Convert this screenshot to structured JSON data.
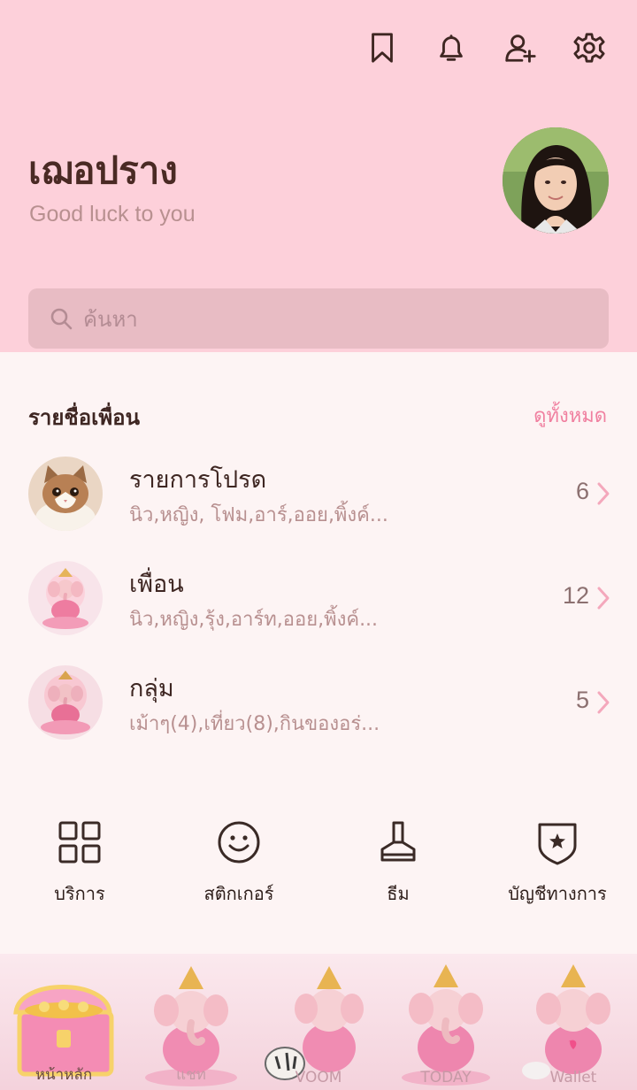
{
  "header": {
    "icons": [
      "bookmark-icon",
      "bell-icon",
      "add-friend-icon",
      "gear-icon"
    ],
    "profile_name": "เฌอปราง",
    "status_message": "Good luck to you"
  },
  "search": {
    "placeholder": "ค้นหา"
  },
  "friends_section": {
    "title": "รายชื่อเพื่อน",
    "view_all": "ดูทั้งหมด",
    "rows": [
      {
        "title": "รายการโปรด",
        "subtitle": "นิว,หญิง, โฟม,อาร์,ออย,พิ้งค์...",
        "count": "6",
        "thumb": "cat"
      },
      {
        "title": "เพื่อน",
        "subtitle": "นิว,หญิง,รุ้ง,อาร์ท,ออย,พิ้งค์...",
        "count": "12",
        "thumb": "ganesha"
      },
      {
        "title": "กลุ่ม",
        "subtitle": "เม้าๆ(4),เที่ยว(8),กินของอร่...",
        "count": "5",
        "thumb": "ganesha"
      }
    ]
  },
  "services": [
    {
      "label": "บริการ",
      "icon": "grid-icon"
    },
    {
      "label": "สติกเกอร์",
      "icon": "smiley-icon"
    },
    {
      "label": "ธีม",
      "icon": "brush-icon"
    },
    {
      "label": "บัญชีทางการ",
      "icon": "official-shield-icon"
    }
  ],
  "tabbar": {
    "tabs": [
      {
        "label": "หน้าหลัก",
        "active": true
      },
      {
        "label": "แชท",
        "active": false
      },
      {
        "label": "VOOM",
        "active": false
      },
      {
        "label": "TODAY",
        "active": false
      },
      {
        "label": "Wallet",
        "active": false
      }
    ]
  },
  "colors": {
    "header_bg": "#fdd0da",
    "accent_pink": "#f080a0",
    "body_bg": "#fdf4f4"
  }
}
